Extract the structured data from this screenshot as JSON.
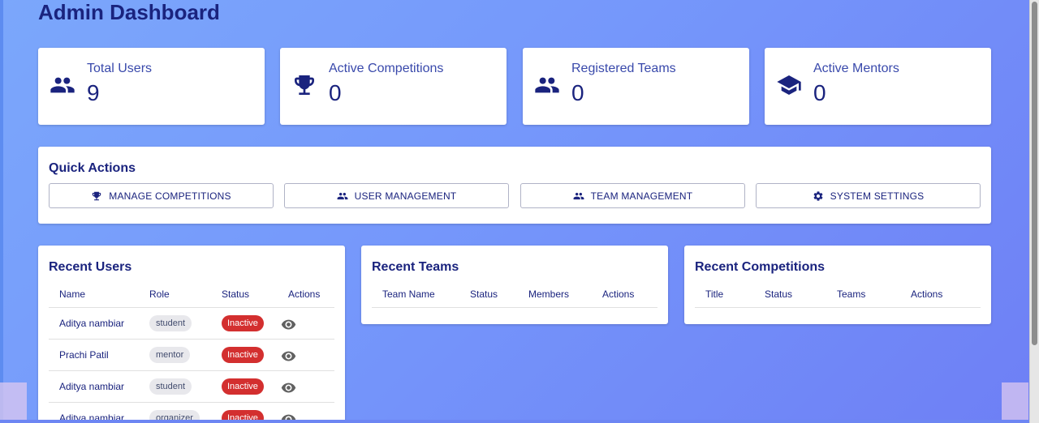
{
  "page": {
    "title": "Admin Dashboard"
  },
  "stats": [
    {
      "label": "Total Users",
      "value": "9",
      "icon": "people-icon"
    },
    {
      "label": "Active Competitions",
      "value": "0",
      "icon": "trophy-icon"
    },
    {
      "label": "Registered Teams",
      "value": "0",
      "icon": "people-icon"
    },
    {
      "label": "Active Mentors",
      "value": "0",
      "icon": "graduation-cap-icon"
    }
  ],
  "quick_actions": {
    "title": "Quick Actions",
    "buttons": [
      {
        "label": "MANAGE COMPETITIONS",
        "icon": "trophy-icon"
      },
      {
        "label": "USER MANAGEMENT",
        "icon": "people-icon"
      },
      {
        "label": "TEAM MANAGEMENT",
        "icon": "people-icon"
      },
      {
        "label": "SYSTEM SETTINGS",
        "icon": "gear-icon"
      }
    ]
  },
  "recent_users": {
    "title": "Recent Users",
    "columns": [
      "Name",
      "Role",
      "Status",
      "Actions"
    ],
    "rows": [
      {
        "name": "Aditya nambiar",
        "role": "student",
        "status": "Inactive"
      },
      {
        "name": "Prachi Patil",
        "role": "mentor",
        "status": "Inactive"
      },
      {
        "name": "Aditya nambiar",
        "role": "student",
        "status": "Inactive"
      },
      {
        "name": "Aditya nambiar",
        "role": "organizer",
        "status": "Inactive"
      }
    ]
  },
  "recent_teams": {
    "title": "Recent Teams",
    "columns": [
      "Team Name",
      "Status",
      "Members",
      "Actions"
    ]
  },
  "recent_competitions": {
    "title": "Recent Competitions",
    "columns": [
      "Title",
      "Status",
      "Teams",
      "Actions"
    ]
  },
  "colors": {
    "primary": "#1a237e",
    "label": "#3949ab",
    "inactive": "#d32f2f",
    "background_start": "#7ba7fb",
    "background_end": "#6e7ff5"
  }
}
